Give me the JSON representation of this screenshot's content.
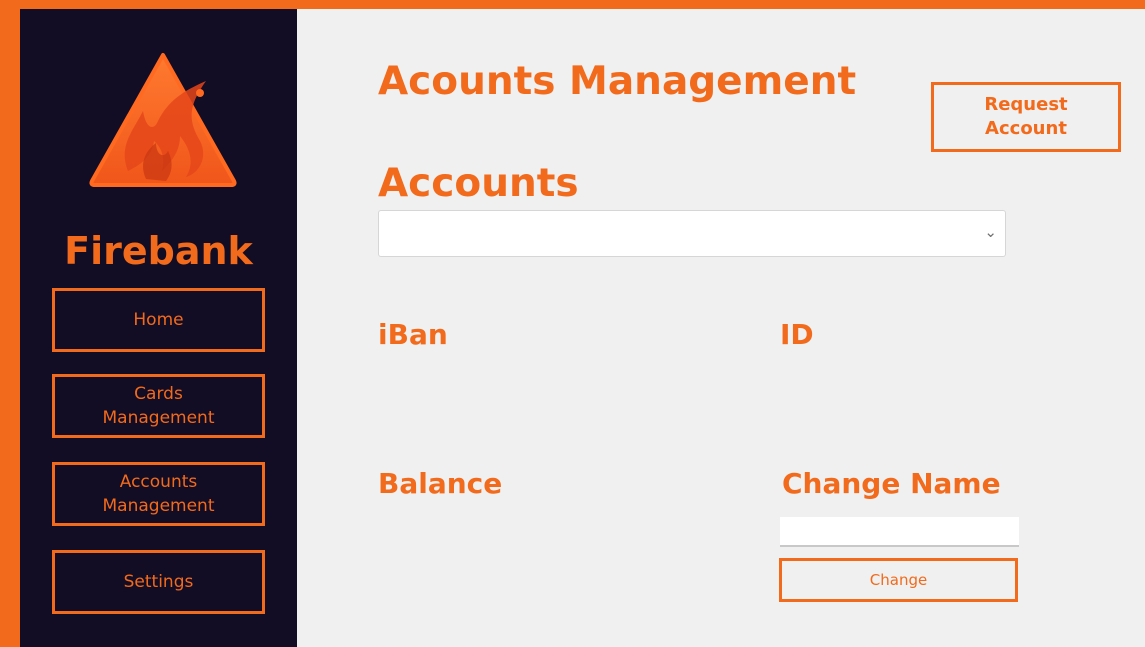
{
  "sidebar": {
    "brand": "Firebank",
    "logo_icon": "fire-triangle-icon",
    "nav": [
      {
        "label": "Home"
      },
      {
        "label": "Cards\nManagement"
      },
      {
        "label": "Accounts\nManagement"
      },
      {
        "label": "Settings"
      }
    ]
  },
  "main": {
    "title": "Acounts Management",
    "request_button": "Request\nAccount",
    "accounts_heading": "Accounts",
    "accounts_select": {
      "value": "",
      "icon": "chevron-down-icon"
    },
    "labels": {
      "iban": "iBan",
      "id": "ID",
      "balance": "Balance",
      "change_name": "Change Name"
    },
    "change_name_input": {
      "value": "",
      "placeholder": ""
    },
    "change_button": "Change"
  },
  "colors": {
    "accent": "#f26a1b",
    "sidebar_bg": "#120d24",
    "content_bg": "#f0f0f0"
  }
}
